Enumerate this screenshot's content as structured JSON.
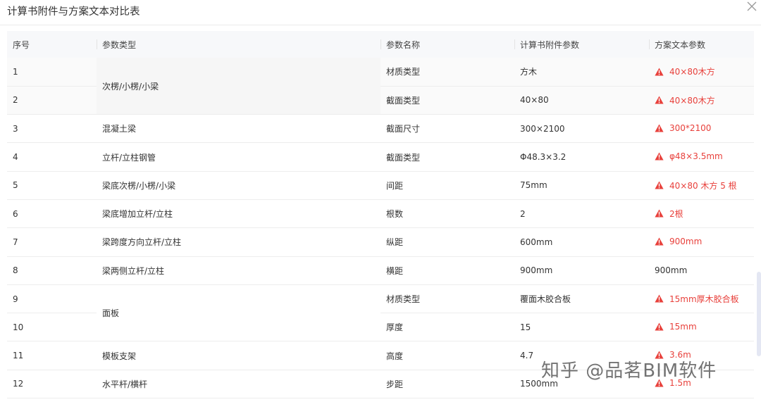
{
  "dialog": {
    "title": "计算书附件与方案文本对比表",
    "close_icon": "close-icon"
  },
  "table": {
    "headers": [
      "序号",
      "参数类型",
      "参数名称",
      "计算书附件参数",
      "方案文本参数"
    ],
    "rows": [
      {
        "no": "1",
        "type": "次楞/小楞/小梁",
        "name": "材质类型",
        "calc": "方木",
        "plan": "40×80木方",
        "mismatch": true
      },
      {
        "no": "2",
        "type": "",
        "name": "截面类型",
        "calc": "40×80",
        "plan": "40×80木方",
        "mismatch": true
      },
      {
        "no": "3",
        "type": "混凝土梁",
        "name": "截面尺寸",
        "calc": "300×2100",
        "plan": "300*2100",
        "mismatch": true
      },
      {
        "no": "4",
        "type": "立杆/立柱钢管",
        "name": "截面类型",
        "calc": "Φ48.3×3.2",
        "plan": "φ48×3.5mm",
        "mismatch": true
      },
      {
        "no": "5",
        "type": "梁底次楞/小楞/小梁",
        "name": "间距",
        "calc": "75mm",
        "plan": "40×80 木方 5 根",
        "mismatch": true
      },
      {
        "no": "6",
        "type": "梁底增加立杆/立柱",
        "name": "根数",
        "calc": "2",
        "plan": "2根",
        "mismatch": true
      },
      {
        "no": "7",
        "type": "梁跨度方向立杆/立柱",
        "name": "纵距",
        "calc": "600mm",
        "plan": "900mm",
        "mismatch": true
      },
      {
        "no": "8",
        "type": "梁两侧立杆/立柱",
        "name": "横距",
        "calc": "900mm",
        "plan": "900mm",
        "mismatch": false
      },
      {
        "no": "9",
        "type": "面板",
        "name": "材质类型",
        "calc": "覆面木胶合板",
        "plan": "15mm厚木胶合板",
        "mismatch": true
      },
      {
        "no": "10",
        "type": "",
        "name": "厚度",
        "calc": "15",
        "plan": "15mm",
        "mismatch": true
      },
      {
        "no": "11",
        "type": "模板支架",
        "name": "高度",
        "calc": "4.7",
        "plan": "3.6m",
        "mismatch": true
      },
      {
        "no": "12",
        "type": "水平杆/横杆",
        "name": "步距",
        "calc": "1500mm",
        "plan": "1.5m",
        "mismatch": true
      }
    ]
  },
  "colors": {
    "mismatch_text": "#e8403b",
    "header_bg": "#f7f8fa"
  },
  "watermark": "知乎 @品茗BIM软件"
}
